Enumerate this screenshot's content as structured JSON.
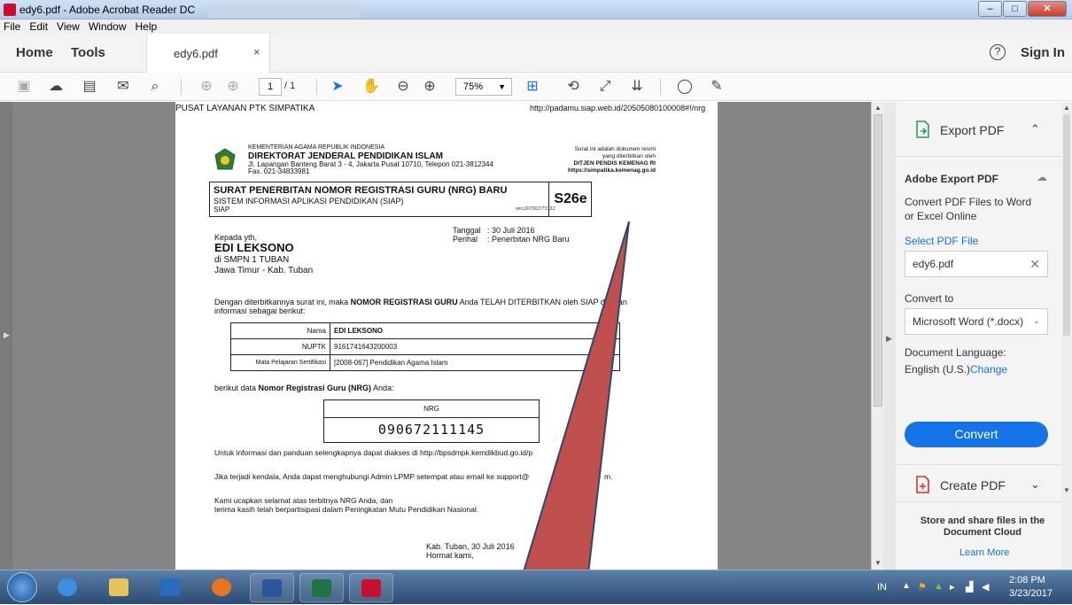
{
  "window": {
    "title": "edy6.pdf - Adobe Acrobat Reader DC",
    "controls": [
      "–",
      "□",
      "✕"
    ]
  },
  "menu": [
    "File",
    "Edit",
    "View",
    "Window",
    "Help"
  ],
  "tabs": {
    "home": "Home",
    "tools": "Tools",
    "doc": "edy6.pdf",
    "close": "×",
    "help": "?",
    "sign_in": "Sign In"
  },
  "toolbar": {
    "page_current": "1",
    "page_total": "/ 1",
    "zoom": "75%"
  },
  "document": {
    "header_left": "PUSAT LAYANAN PTK SIMPATIKA",
    "header_right": "http://padamu.siap.web.id/20505080100008#!/nrg",
    "ministry": "KEMENTERIAN AGAMA REPUBLIK INDONESIA",
    "directorate": "DIREKTORAT JENDERAL PENDIDIKAN ISLAM",
    "address": "Jl. Lapangan Banteng Barat 3 - 4, Jakarta Pusat 10710, Telepon 021-3812344",
    "fax": "Fax. 021-34833981",
    "note1": "Surat ini adalah dokumen resmi",
    "note2": "yang diterbitkan oleh",
    "note3": "DITJEN PENDIS KEMENAG RI",
    "note4": "https://simpatika.kemenag.go.id",
    "title": "SURAT PENERBITAN NOMOR REGISTRASI GURU (NRG) BARU",
    "subtitle": "SISTEM INFORMASI APLIKASI PENDIDIKAN (SIAP)",
    "siap": "SIAP",
    "version": "ver.201502171332",
    "code": "S26e",
    "tanggal_label": "Tanggal",
    "tanggal_value": ": 30 Juli 2016",
    "perihal_label": "Perihal",
    "perihal_value": ": Penerbitan NRG Baru",
    "kepada": "Kepada yth,",
    "recipient": "EDI LEKSONO",
    "school": "di SMPN 1 TUBAN",
    "region": "Jawa Timur - Kab. Tuban",
    "para1_a": "Dengan diterbitkannya surat ini, maka ",
    "para1_b": "NOMOR REGISTRASI GURU",
    "para1_c": " Anda TELAH DITERBITKAN oleh SIAP dengan",
    "para1_d": "informasi sebagai berikut:",
    "table": [
      {
        "label": "Nama",
        "value": "EDI LEKSONO"
      },
      {
        "label": "NUPTK",
        "value": "9161741643200003"
      },
      {
        "label": "Mata Pelajaran Sertifikasi",
        "value": "[2008-067] Pendidikan Agama Islam"
      }
    ],
    "nrg_intro_a": "berikut data ",
    "nrg_intro_b": "Nomor Registrasi Guru (NRG)",
    "nrg_intro_c": " Anda:",
    "nrg_label": "NRG",
    "nrg_value": "090672111145",
    "info1": "Untuk informasi dan panduan selengkapnya dapat diakses di http://bpsdmpk.kemdikbud.go.id/p",
    "info2": "Jika terjadi kendala, Anda dapat menghubungi Admin LPMP setempat atau email ke support@",
    "info2_end": "m.",
    "thanks1": "Kami ucapkan selamat atas terbitnya NRG Anda, dan",
    "thanks2": "terima kasih telah berpartisipasi dalam Peningkatan Mutu Pendidikan Nasional.",
    "place_date": "Kab. Tuban, 30 Juli 2016",
    "regards": "Hormat kami,"
  },
  "right_panel": {
    "export_pdf": "Export PDF",
    "adobe_export": "Adobe Export PDF",
    "convert_desc": "Convert PDF Files to Word or Excel Online",
    "select_file": "Select PDF File",
    "file_name": "edy6.pdf",
    "convert_to": "Convert to",
    "format": "Microsoft Word (*.docx)",
    "doc_language": "Document Language:",
    "language": "English (U.S.)",
    "change": "Change",
    "convert": "Convert",
    "create_pdf": "Create PDF",
    "store_share": "Store and share files in the Document Cloud",
    "learn_more": "Learn More"
  },
  "taskbar": {
    "lang": "IN",
    "time": "2:08 PM",
    "date": "3/23/2017"
  },
  "colors": {
    "accent": "#1473e6",
    "arrow": "#c0504d"
  }
}
